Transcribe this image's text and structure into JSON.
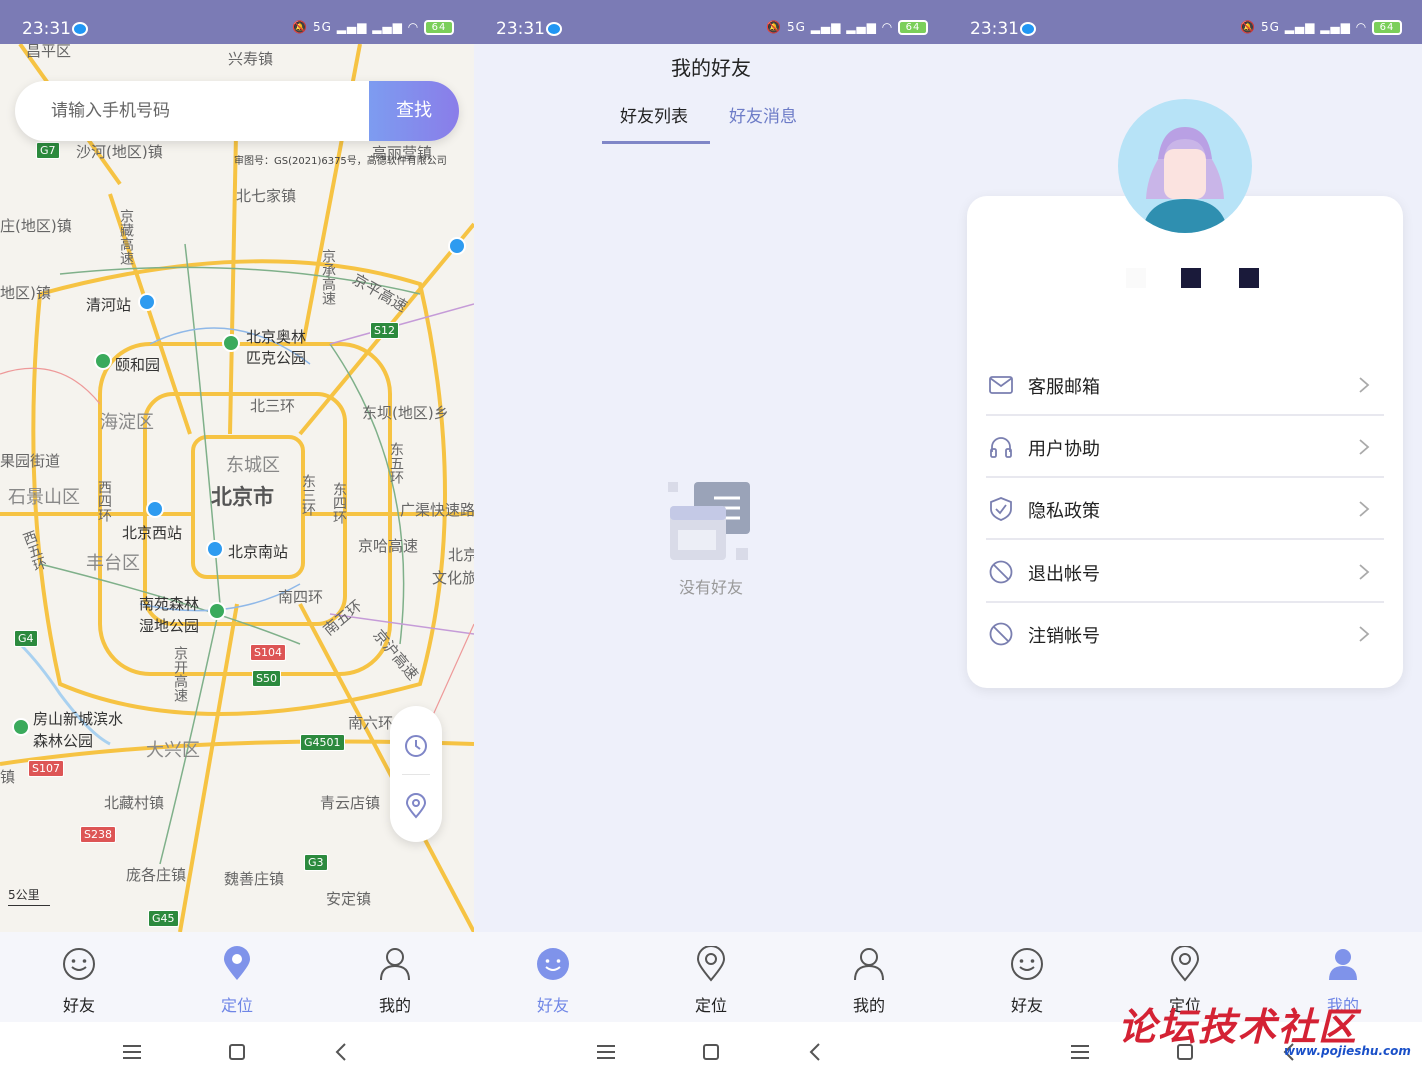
{
  "status": {
    "time": "23:31",
    "battery": "64",
    "net": "5G"
  },
  "map": {
    "search_placeholder": "请输入手机号码",
    "search_button": "查找",
    "approval": "审图号：GS(2021)6375号，高德软件有限公司",
    "scale": "5公里",
    "labels": {
      "city": "北京市",
      "haidian": "海淀区",
      "dongcheng": "东城区",
      "fengtai": "丰台区",
      "shijingshan": "石景山区",
      "daxing": "大兴区",
      "qinghe": "清河站",
      "yiheyuan": "颐和园",
      "olympic1": "北京奥林",
      "olympic2": "匹克公园",
      "beijingxi": "北京西站",
      "beijingnan": "北京南站",
      "nanyuan1": "南苑森林",
      "nanyuan2": "湿地公园",
      "fangshan1": "房山新城滨水",
      "fangshan2": "森林公园",
      "xingshou": "兴寿镇",
      "beiqijia": "北七家镇",
      "shahe": "沙河(地区)镇",
      "dongba": "东坝(地区)乡",
      "beisanhuan": "北三环",
      "nansihuan": "南四环",
      "nanwuhuan": "南五环",
      "nanliuhuan": "南六环",
      "jinghagaosu": "京哈高速",
      "jingpinggaosu": "京平高速",
      "beizang": "北藏村镇",
      "qingyundian": "青云店镇",
      "pangezhuang": "庞各庄镇",
      "weishanzhuang": "魏善庄镇",
      "anding": "安定镇",
      "gaoliying": "高丽营镇",
      "guoyuan": "果园街道",
      "guangqu": "广渠快速路",
      "wenhua": "文化旅",
      "beijing_right": "北京",
      "xiwuhuan": "西五环",
      "xisihuan": "西四环",
      "dongsanhuan": "东三环",
      "dongsihuan": "东四环",
      "dongwuhuan": "东五环",
      "jingzanggaosu": "京藏高速",
      "jingchenggaosu": "京承高速",
      "jingkaigaosu": "京开高速",
      "jinghugaosu": "京沪高速",
      "tuancheng": "庄(地区)镇",
      "zhen_left": "地区)镇",
      "changping": "昌平区",
      "zhen_bottom": "镇"
    },
    "shields": [
      "G7",
      "S12",
      "G4",
      "S50",
      "G4501",
      "G3",
      "G45",
      "S104",
      "S238",
      "S107"
    ]
  },
  "tabs": {
    "friends": "好友",
    "location": "定位",
    "mine": "我的"
  },
  "friends": {
    "title": "我的好友",
    "tab_list": "好友列表",
    "tab_messages": "好友消息",
    "empty": "没有好友"
  },
  "profile": {
    "menu": [
      {
        "label": "客服邮箱",
        "icon": "mail-icon"
      },
      {
        "label": "用户协助",
        "icon": "headset-icon"
      },
      {
        "label": "隐私政策",
        "icon": "shield-check-icon"
      },
      {
        "label": "退出帐号",
        "icon": "ban-icon"
      },
      {
        "label": "注销帐号",
        "icon": "ban-icon"
      }
    ]
  },
  "watermark": {
    "text": "论坛技术社区",
    "url": "www.pojieshu.com"
  },
  "colors": {
    "accent": "#6f86e6",
    "statusbar": "#7b7bb5",
    "background": "#eef0fa"
  }
}
